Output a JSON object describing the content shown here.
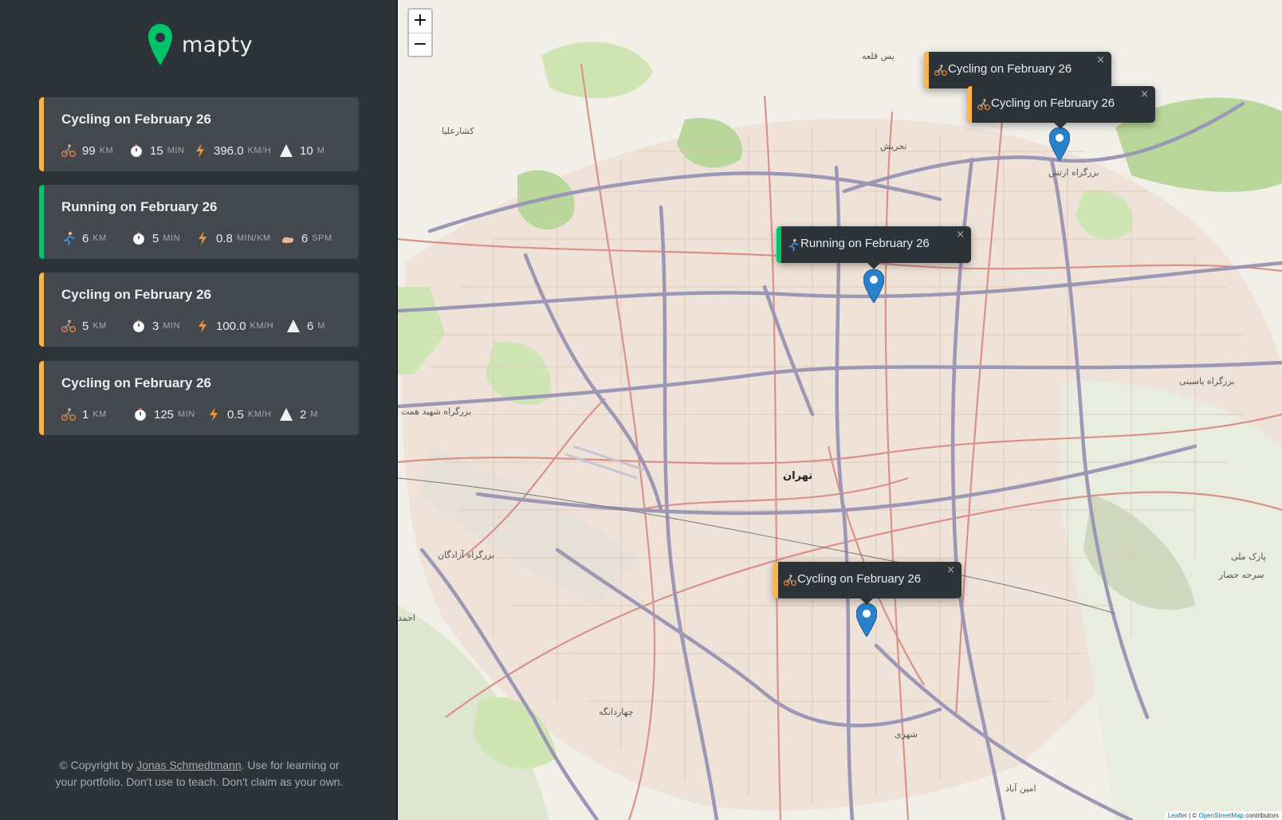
{
  "app": {
    "name": "mapty"
  },
  "workouts": [
    {
      "type": "cycling",
      "title": "Cycling on February 26",
      "distance": "99",
      "distance_unit": "km",
      "duration": "15",
      "duration_unit": "min",
      "speed": "396.0",
      "speed_unit": "km/h",
      "extra": "10",
      "extra_unit": "m"
    },
    {
      "type": "running",
      "title": "Running on February 26",
      "distance": "6",
      "distance_unit": "km",
      "duration": "5",
      "duration_unit": "min",
      "speed": "0.8",
      "speed_unit": "min/km",
      "extra": "6",
      "extra_unit": "spm"
    },
    {
      "type": "cycling",
      "title": "Cycling on February 26",
      "distance": "5",
      "distance_unit": "km",
      "duration": "3",
      "duration_unit": "min",
      "speed": "100.0",
      "speed_unit": "km/h",
      "extra": "6",
      "extra_unit": "m"
    },
    {
      "type": "cycling",
      "title": "Cycling on February 26",
      "distance": "1",
      "distance_unit": "km",
      "duration": "125",
      "duration_unit": "min",
      "speed": "0.5",
      "speed_unit": "km/h",
      "extra": "2",
      "extra_unit": "m"
    }
  ],
  "footer": {
    "prefix": "© Copyright by ",
    "author": "Jonas Schmedtmann",
    "suffix": ". Use for learning or your portfolio. Don't use to teach. Don't claim as your own."
  },
  "map": {
    "zoom_in": "+",
    "zoom_out": "−",
    "popups": [
      {
        "type": "cycling",
        "text": "Cycling on February 26",
        "close": "×"
      },
      {
        "type": "cycling",
        "text": "Cycling on February 26",
        "close": "×"
      },
      {
        "type": "running",
        "text": "Running on February 26",
        "close": "×"
      },
      {
        "type": "cycling",
        "text": "Cycling on February 26",
        "close": "×"
      }
    ],
    "labels": {
      "city": "تهران",
      "tajrish": "تجریش",
      "east_hwy": "بزرگراه یاسینی",
      "west_hwy": "بزرگراه شهید همت",
      "south_hwy": "بزرگراه آزادگان",
      "park": "پارک ملی",
      "park2": "سرحه حصار",
      "shahr_rey": "شهری",
      "chahardangeh": "چهاردانگه",
      "north_hwy": "بزرگراه ارتش",
      "kashar": "کشارعلیا",
      "poshtqale": "پس قلعه",
      "ahmad": "احمد",
      "amin": "امین آباد"
    },
    "attribution": {
      "leaflet": "Leaflet",
      "sep": " | © ",
      "osm": "OpenStreetMap",
      "suffix": " contributors"
    }
  },
  "colors": {
    "cycling": "#ffb545",
    "running": "#00c46a",
    "sidebar": "#2d3439",
    "card": "#42484d",
    "marker": "#2a81cb"
  },
  "icons": {
    "cycling": "cyclist-icon",
    "running": "runner-icon",
    "duration": "stopwatch-icon",
    "speed": "lightning-icon",
    "elevation": "mountain-icon",
    "cadence": "foot-icon",
    "logo": "location-pin-icon",
    "marker": "map-marker-icon"
  }
}
